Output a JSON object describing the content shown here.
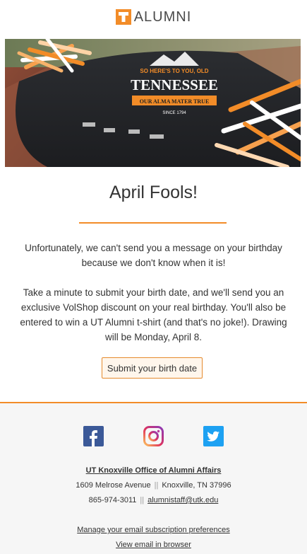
{
  "header": {
    "logo_letter": "T",
    "logo_text": "ALUMNI"
  },
  "hero": {
    "shirt_line1": "SO HERE'S TO YOU, OLD",
    "shirt_line2": "TENNESSEE",
    "shirt_line3": "OUR ALMA MATER TRUE",
    "shirt_line4": "SINCE 1794"
  },
  "main": {
    "title": "April Fools!",
    "paragraph1": "Unfortunately, we can't send you a message on your birthday because we don't know when it is!",
    "paragraph2": "Take a minute to submit your birth date, and we'll send you an exclusive VolShop discount on your real birthday. You'll also be entered to win a UT Alumni t-shirt (and that's no joke!). Drawing will be Monday, April 8.",
    "cta_label": "Submit your birth date"
  },
  "footer": {
    "social": [
      "facebook-icon",
      "instagram-icon",
      "twitter-icon"
    ],
    "office": "UT Knoxville Office of Alumni Affairs",
    "street": "1609 Melrose Avenue",
    "city": "Knoxville, TN 37996",
    "phone": "865-974-3011",
    "email": "alumnistaff@utk.edu",
    "separator": "||",
    "manage": "Manage your email subscription preferences",
    "view": "View email in browser"
  },
  "colors": {
    "accent": "#f28c28",
    "facebook": "#3b5998",
    "twitter": "#1da1f2"
  }
}
